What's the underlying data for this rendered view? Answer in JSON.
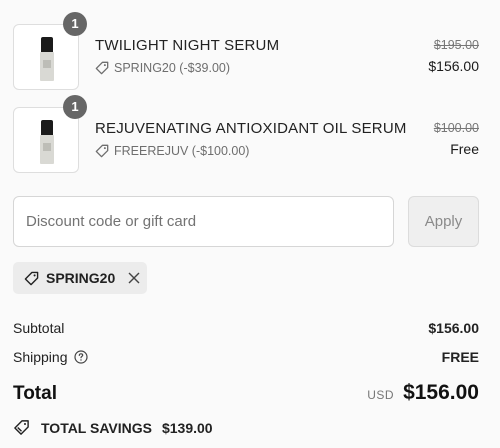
{
  "items": [
    {
      "quantity": "1",
      "name": "TWILIGHT NIGHT SERUM",
      "discount_label": "SPRING20 (-$39.00)",
      "original_price": "$195.00",
      "price": "$156.00"
    },
    {
      "quantity": "1",
      "name": "REJUVENATING ANTIOXIDANT OIL SERUM",
      "discount_label": "FREEREJUV (-$100.00)",
      "original_price": "$100.00",
      "price": "Free"
    }
  ],
  "discount": {
    "placeholder": "Discount code or gift card",
    "value": "",
    "apply_label": "Apply"
  },
  "applied_code": {
    "label": "SPRING20"
  },
  "summary": {
    "subtotal_label": "Subtotal",
    "subtotal_value": "$156.00",
    "shipping_label": "Shipping",
    "shipping_value": "FREE",
    "total_label": "Total",
    "currency": "USD",
    "total_value": "$156.00",
    "savings_label": "TOTAL SAVINGS",
    "savings_value": "$139.00"
  },
  "icons": {
    "tag": "tag-icon",
    "remove": "close-icon",
    "info": "info-icon",
    "savings": "savings-tag-icon"
  },
  "colors": {
    "badge": "#666666",
    "chip_background": "#ececec",
    "apply_background": "#efefef"
  }
}
